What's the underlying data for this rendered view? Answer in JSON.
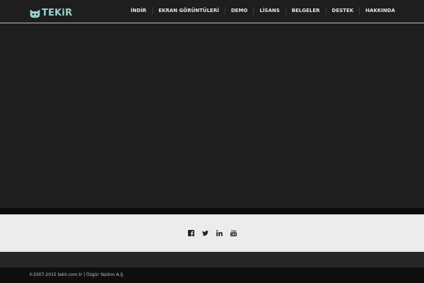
{
  "header": {
    "logo_text": "TEKiR",
    "logo_icon": "cat-face-icon",
    "nav": [
      "İNDİR",
      "EKRAN GÖRÜNTÜLERİ",
      "DEMO",
      "LİSANS",
      "BELGELER",
      "DESTEK",
      "HAKKINDA"
    ]
  },
  "social": {
    "icons": [
      "facebook-icon",
      "twitter-icon",
      "linkedin-icon",
      "youtube-icon"
    ]
  },
  "footer": {
    "copyright": "©2007-2015 tekir.com.tr | Özgür Yazılım A.Ş."
  },
  "colors": {
    "background": "#1e1e1e",
    "logo": "#9ad3d0",
    "social_bar": "#ececec",
    "footer": "#0e0e0e"
  }
}
